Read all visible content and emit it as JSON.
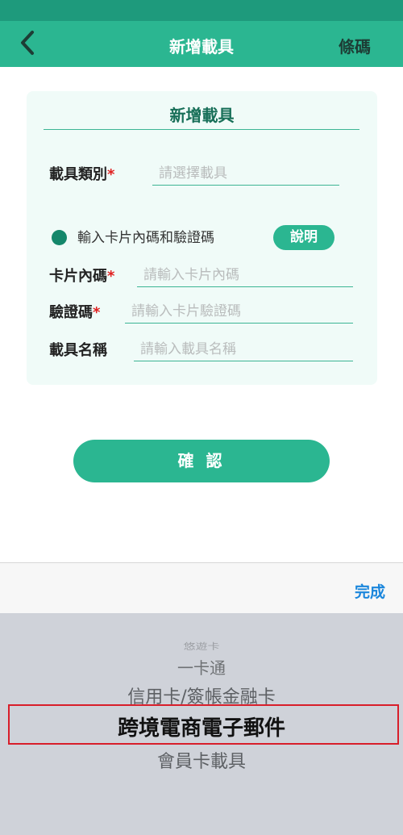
{
  "nav": {
    "title": "新增載具",
    "right_label": "條碼"
  },
  "card": {
    "title": "新增載具",
    "carrier_type": {
      "label": "載具類別",
      "required": "*",
      "placeholder": "請選擇載具"
    },
    "radio_option": "輸入卡片內碼和驗證碼",
    "explain_button": "說明",
    "card_code": {
      "label": "卡片內碼",
      "required": "*",
      "placeholder": "請輸入卡片內碼"
    },
    "verify_code": {
      "label": "驗證碼",
      "required": "*",
      "placeholder": "請輸入卡片驗證碼"
    },
    "carrier_name": {
      "label": "載具名稱",
      "placeholder": "請輸入載具名稱"
    }
  },
  "confirm_button": "確 認",
  "picker": {
    "done_label": "完成",
    "options": [
      "悠遊卡",
      "一卡通",
      "信用卡/簽帳金融卡",
      "跨境電商電子郵件",
      "會員卡載具"
    ],
    "selected_index": 3
  },
  "colors": {
    "primary": "#2bb691",
    "primary_dark": "#1e9a7c",
    "required": "#e02020",
    "done": "#1a86dc"
  }
}
